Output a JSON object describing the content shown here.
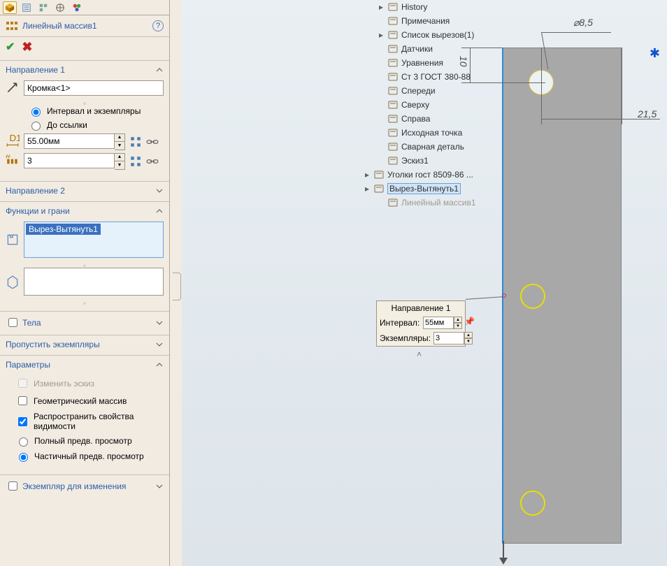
{
  "panel": {
    "title": "Линейный массив1",
    "direction1": {
      "heading": "Направление 1",
      "edge": "Кромка<1>",
      "radio_interval": "Интервал и экземпляры",
      "radio_ref": "До ссылки",
      "spacing": "55.00мм",
      "count": "3"
    },
    "direction2": {
      "heading": "Направление 2"
    },
    "features": {
      "heading": "Функции и грани",
      "selected": "Вырез-Вытянуть1"
    },
    "bodies": {
      "heading": "Тела"
    },
    "skip": {
      "heading": "Пропустить экземпляры"
    },
    "params": {
      "heading": "Параметры",
      "edit_sketch": "Изменить эскиз",
      "geom_array": "Геометрический массив",
      "propagate_vis": "Распространить свойства видимости",
      "full_preview": "Полный предв. просмотр",
      "partial_preview": "Частичный предв. просмотр"
    },
    "inst_mod": {
      "heading": "Экземпляр для изменения"
    }
  },
  "tree": [
    {
      "ind": 1,
      "exp": "▸",
      "label": "History"
    },
    {
      "ind": 1,
      "exp": "",
      "label": "Примечания"
    },
    {
      "ind": 1,
      "exp": "▸",
      "label": "Список вырезов(1)"
    },
    {
      "ind": 1,
      "exp": "",
      "label": "Датчики"
    },
    {
      "ind": 1,
      "exp": "",
      "label": "Уравнения"
    },
    {
      "ind": 1,
      "exp": "",
      "label": "Ст 3 ГОСТ 380-88"
    },
    {
      "ind": 1,
      "exp": "",
      "label": "Спереди"
    },
    {
      "ind": 1,
      "exp": "",
      "label": "Сверху"
    },
    {
      "ind": 1,
      "exp": "",
      "label": "Справа"
    },
    {
      "ind": 1,
      "exp": "",
      "label": "Исходная точка"
    },
    {
      "ind": 1,
      "exp": "",
      "label": "Сварная деталь"
    },
    {
      "ind": 1,
      "exp": "",
      "label": "Эскиз1"
    },
    {
      "ind": 0,
      "exp": "▸",
      "label": "Уголки гост 8509-86 ..."
    },
    {
      "ind": 0,
      "exp": "▸",
      "label": "Вырез-Вытянуть1",
      "selected": true
    },
    {
      "ind": 1,
      "exp": "",
      "label": "Линейный массив1",
      "dim": true
    }
  ],
  "popup": {
    "title": "Направление 1",
    "interval_lbl": "Интервал:",
    "interval_val": "55мм",
    "count_lbl": "Экземпляры:",
    "count_val": "3"
  },
  "dims": {
    "diam": "⌀8,5",
    "offset_v": "10",
    "offset_h": "21,5"
  }
}
